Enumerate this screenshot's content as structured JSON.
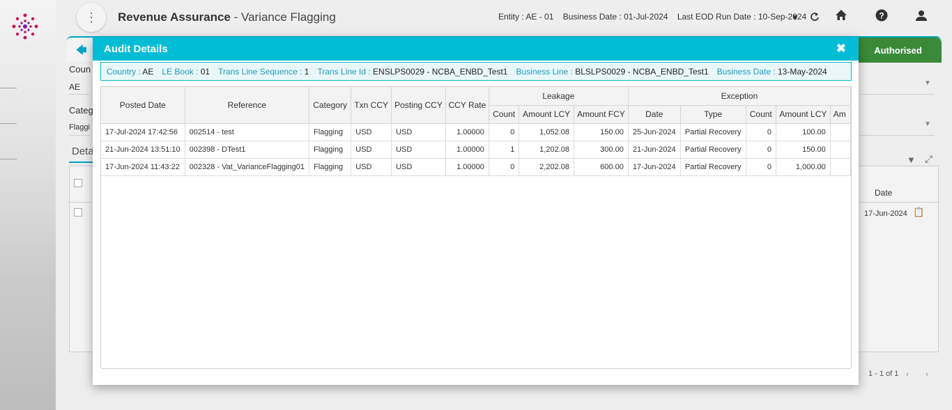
{
  "header": {
    "app_name": "Revenue Assurance",
    "separator": " - ",
    "page_name": "Variance Flagging",
    "entity": "Entity : AE - 01",
    "business_date": "Business Date : 01-Jul-2024",
    "last_eod": "Last EOD Run Date : 10-Sep-2024"
  },
  "background": {
    "status_tab": "Authorised",
    "country_label": "Coun",
    "country_value": "AE",
    "category_label": "Categ",
    "category_value": "Flaggi",
    "details_tab": "Deta",
    "grid_date_header": "Date",
    "grid_date_value": "17-Jun-2024",
    "pager": "1 - 1 of 1"
  },
  "modal": {
    "title": "Audit Details",
    "info": [
      {
        "key": "Country : ",
        "value": "AE"
      },
      {
        "key": "LE Book : ",
        "value": "01"
      },
      {
        "key": "Trans Line Sequence : ",
        "value": "1"
      },
      {
        "key": "Trans Line Id : ",
        "value": "ENSLPS0029 - NCBA_ENBD_Test1"
      },
      {
        "key": "Business Line : ",
        "value": "BLSLPS0029 - NCBA_ENBD_Test1"
      },
      {
        "key": "Business Date : ",
        "value": "13-May-2024"
      }
    ],
    "groups": {
      "leakage": "Leakage",
      "exception": "Exception"
    },
    "columns": {
      "posted_date": "Posted Date",
      "reference": "Reference",
      "category": "Category",
      "txn_ccy": "Txn CCY",
      "posting_ccy": "Posting CCY",
      "ccy_rate": "CCY Rate",
      "l_count": "Count",
      "l_amount_lcy": "Amount LCY",
      "l_amount_fcy": "Amount FCY",
      "e_date": "Date",
      "e_type": "Type",
      "e_count": "Count",
      "e_amount_lcy": "Amount LCY",
      "e_amount_fcy": "Am"
    },
    "rows": [
      [
        "17-Jul-2024 17:42:56",
        "002514 - test",
        "Flagging",
        "USD",
        "USD",
        "1.00000",
        "0",
        "1,052.08",
        "150.00",
        "25-Jun-2024",
        "Partial Recovery",
        "0",
        "100.00"
      ],
      [
        "21-Jun-2024 13:51:10",
        "002398 - DTest1",
        "Flagging",
        "USD",
        "USD",
        "1.00000",
        "1",
        "1,202.08",
        "300.00",
        "21-Jun-2024",
        "Partial Recovery",
        "0",
        "150.00"
      ],
      [
        "17-Jun-2024 11:43:22",
        "002328 - Vat_VarianceFlagging01",
        "Flagging",
        "USD",
        "USD",
        "1.00000",
        "0",
        "2,202.08",
        "600.00",
        "17-Jun-2024",
        "Partial Recovery",
        "0",
        "1,000.00"
      ]
    ]
  },
  "colors": {
    "accent": "#00bcd4",
    "authorised": "#3a8a3a",
    "info_key": "#1a9cc0"
  }
}
